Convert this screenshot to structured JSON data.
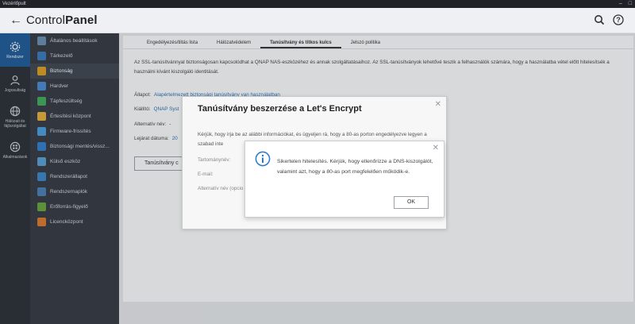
{
  "window": {
    "title": "Vezérlőpult",
    "controls": [
      "–",
      "□"
    ]
  },
  "app": {
    "title_light": "Control",
    "title_bold": "Panel"
  },
  "rail": [
    {
      "label": "Rendszer",
      "icon": "gear-icon",
      "active": true
    },
    {
      "label": "Jogosultság",
      "icon": "user-icon",
      "active": false
    },
    {
      "label": "Hálózati és fájlszolgáltat",
      "icon": "network-icon",
      "active": false
    },
    {
      "label": "Alkalmazások",
      "icon": "apps-icon",
      "active": false
    }
  ],
  "sidebar": {
    "items": [
      {
        "label": "Általános beállítások",
        "color": "#6b8fb5"
      },
      {
        "label": "Tárkezelő",
        "color": "#3a7ac0"
      },
      {
        "label": "Biztonság",
        "color": "#e0a020",
        "active": true
      },
      {
        "label": "Hardver",
        "color": "#4b8bd6"
      },
      {
        "label": "Tápfeszültség",
        "color": "#3fae5a"
      },
      {
        "label": "Értesítési központ",
        "color": "#e8b13a"
      },
      {
        "label": "Firmware-frissítés",
        "color": "#4a9fe0"
      },
      {
        "label": "Biztonsági mentés/vissz...",
        "color": "#2f7fd0"
      },
      {
        "label": "Külső eszköz",
        "color": "#5aa0d8"
      },
      {
        "label": "Rendszerállapot",
        "color": "#3a88c8"
      },
      {
        "label": "Rendszernaplók",
        "color": "#4a7fb8"
      },
      {
        "label": "Erőforrás-figyelő",
        "color": "#6aa83a"
      },
      {
        "label": "Licencközpont",
        "color": "#e07a2a"
      }
    ]
  },
  "tabs": [
    {
      "label": "Engedélyezés/tiltás lista",
      "active": false
    },
    {
      "label": "Hálózatvédelem",
      "active": false
    },
    {
      "label": "Tanúsítvány és titkos kulcs",
      "active": true
    },
    {
      "label": "Jelszó politika",
      "active": false
    }
  ],
  "main": {
    "description": "Az SSL-tanúsítvánnyal biztonságosan kapcsolódhat a QNAP NAS-eszközéhez és annak szolgáltatásaihoz. Az SSL-tanúsítványok lehetővé teszik a felhasználók számára, hogy a használatba vétel előtt hitelesítsék a használni kívánt kiszolgáló identitását.",
    "status_label": "Állapot:",
    "status_value": "Alapértelmezett biztonsági tanúsítvány van használatban",
    "issuer_label": "Kiállító:",
    "issuer_value": "QNAP Syst",
    "altname_label": "Alternatív név:",
    "altname_value": "-",
    "expiry_label": "Lejárat dátuma:",
    "expiry_value": "20",
    "cert_button": "Tanúsítvány c"
  },
  "dialog1": {
    "title": "Tanúsítvány beszerzése a Let's Encrypt",
    "text": "Kérjük, hogy írja be az alábbi információkat, és ügyeljen rá, hogy a 80-as porton engedélyezve legyen a szabad inte",
    "domain_label": "Tartománynév:",
    "email_label": "E-mail:",
    "altname_label": "Alternatív név (opcio"
  },
  "dialog2": {
    "message": "Sikertelen hitelesítés. Kérjük, hogy ellenőrizze a DNS-kiszolgálót, valamint azt, hogy a 80-as port megfelelően működik-e.",
    "ok_label": "OK",
    "icon": "info-icon"
  }
}
